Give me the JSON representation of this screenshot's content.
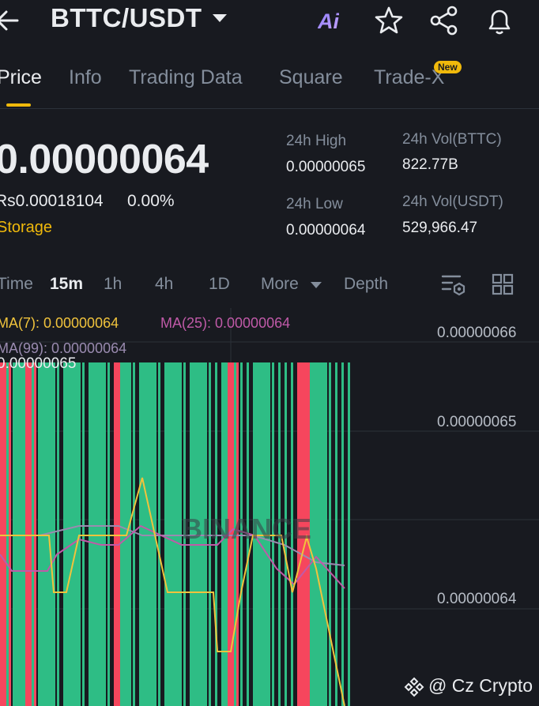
{
  "header": {
    "pair": "BTTC/USDT",
    "ai_label": "Ai"
  },
  "tabs": [
    {
      "label": "Price",
      "active": true
    },
    {
      "label": "Info"
    },
    {
      "label": "Trading Data"
    },
    {
      "label": "Square"
    },
    {
      "label": "Trade-X",
      "badge": "New"
    }
  ],
  "price": {
    "last": "0.00000064",
    "fiat": "Rs0.00018104",
    "change": "0.00%",
    "tag": "Storage"
  },
  "stats": {
    "high_label": "24h High",
    "high_value": "0.00000065",
    "low_label": "24h Low",
    "low_value": "0.00000064",
    "vol_base_label": "24h Vol(BTTC)",
    "vol_base_value": "822.77B",
    "vol_quote_label": "24h Vol(USDT)",
    "vol_quote_value": "529,966.47"
  },
  "intervals": {
    "time": "Time",
    "m15": "15m",
    "h1": "1h",
    "h4": "4h",
    "d1": "1D",
    "more": "More",
    "depth": "Depth"
  },
  "indicators": {
    "ma7": "MA(7): 0.00000064",
    "ma25": "MA(25): 0.00000064",
    "ma99": "MA(99): 0.00000064"
  },
  "chart_data": {
    "type": "candlestick",
    "high_marker": "0.00000065",
    "y_ticks": [
      "0.00000066",
      "0.00000065",
      "0.00000064"
    ],
    "ma_colors": {
      "ma7": "#f0c33c",
      "ma25": "#c05aa8",
      "ma99": "#9a8bb0"
    },
    "up_color": "#2ebd85",
    "down_color": "#f6465d",
    "candles": [
      {
        "dir": "down"
      },
      {
        "dir": "up"
      },
      {
        "dir": "up"
      },
      {
        "dir": "up"
      },
      {
        "dir": "down"
      },
      {
        "dir": "up"
      },
      {
        "dir": "up"
      },
      {
        "dir": "up"
      },
      {
        "dir": "up"
      },
      {
        "dir": "up"
      },
      {
        "dir": "up"
      },
      {
        "dir": "up"
      },
      {
        "dir": "up"
      },
      {
        "dir": "up"
      },
      {
        "dir": "up"
      },
      {
        "dir": "up"
      },
      {
        "dir": "up"
      },
      {
        "dir": "up"
      },
      {
        "dir": "down"
      },
      {
        "dir": "up"
      },
      {
        "dir": "up"
      },
      {
        "dir": "up"
      },
      {
        "dir": "up"
      },
      {
        "dir": "up"
      },
      {
        "dir": "up"
      },
      {
        "dir": "up"
      },
      {
        "dir": "up"
      },
      {
        "dir": "up"
      },
      {
        "dir": "up"
      },
      {
        "dir": "up"
      },
      {
        "dir": "up"
      },
      {
        "dir": "up"
      },
      {
        "dir": "up"
      },
      {
        "dir": "up"
      },
      {
        "dir": "up"
      },
      {
        "dir": "up"
      },
      {
        "dir": "down"
      },
      {
        "dir": "up"
      },
      {
        "dir": "up"
      },
      {
        "dir": "up"
      },
      {
        "dir": "up"
      },
      {
        "dir": "up"
      },
      {
        "dir": "up"
      },
      {
        "dir": "up"
      },
      {
        "dir": "up"
      },
      {
        "dir": "up"
      },
      {
        "dir": "up"
      },
      {
        "dir": "down"
      },
      {
        "dir": "down"
      },
      {
        "dir": "up"
      },
      {
        "dir": "up"
      },
      {
        "dir": "up"
      },
      {
        "dir": "up"
      },
      {
        "dir": "up"
      },
      {
        "dir": "up"
      },
      {
        "dir": "up"
      }
    ]
  },
  "watermark": {
    "brand": "BINANCE",
    "credit": "@ Cz Crypto"
  }
}
